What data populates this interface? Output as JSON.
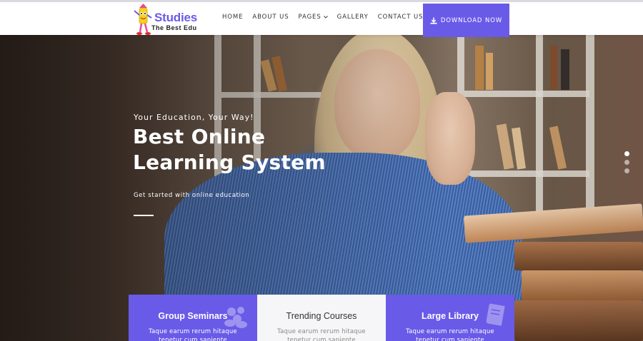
{
  "brand": {
    "name": "Studies",
    "tagline": "The Best Edu"
  },
  "nav": {
    "items": [
      {
        "label": "HOME"
      },
      {
        "label": "ABOUT US"
      },
      {
        "label": "PAGES",
        "has_dropdown": true
      },
      {
        "label": "GALLERY"
      },
      {
        "label": "CONTACT US"
      }
    ],
    "download_label": "DOWNLOAD NOW"
  },
  "hero": {
    "tagline": "Your Education, Your Way!",
    "title_line1": "Best Online",
    "title_line2": "Learning System",
    "subtitle": "Get started with online education",
    "slides": 3,
    "active_slide": 1
  },
  "features": [
    {
      "title": "Group Seminars",
      "desc": "Taque earum rerum hitaque tenetur cum sapiente",
      "style": "purple",
      "icon": "group-icon"
    },
    {
      "title": "Trending Courses",
      "desc": "Taque earum rerum hitaque tenetur cum sapiente",
      "style": "white",
      "icon": "none"
    },
    {
      "title": "Large Library",
      "desc": "Taque earum rerum hitaque tenetur cum sapiente",
      "style": "purple",
      "icon": "book-icon"
    }
  ],
  "colors": {
    "accent": "#6a5ae8",
    "text_dark": "#333333",
    "hero_text": "#ffffff"
  }
}
